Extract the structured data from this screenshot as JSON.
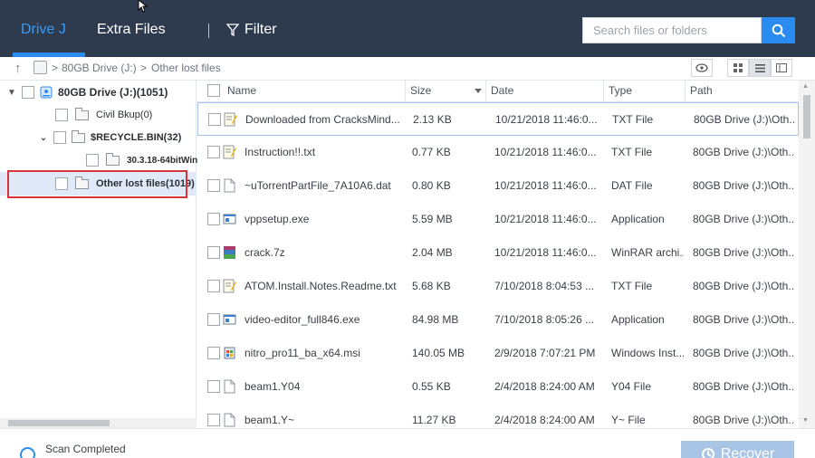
{
  "header": {
    "tabs": [
      {
        "label": "Drive J",
        "active": true
      },
      {
        "label": "Extra Files",
        "active": false
      }
    ],
    "filter_label": "Filter",
    "search": {
      "placeholder": "Search files or folders"
    }
  },
  "breadcrumb": {
    "items": [
      "80GB Drive (J:)",
      "Other lost files"
    ],
    "separator": ">"
  },
  "tree": {
    "root": {
      "label": "80GB Drive (J:)(1051)",
      "icon": "drive-icon"
    },
    "items": [
      {
        "label": "Civil Bkup(0)"
      },
      {
        "label": "$RECYCLE.BIN(32)"
      },
      {
        "label": "30.3.18-64bitWin"
      },
      {
        "label": "Other lost files(1019)",
        "selected": true
      }
    ]
  },
  "table": {
    "columns": [
      "Name",
      "Size",
      "Date",
      "Type",
      "Path"
    ],
    "rows": [
      {
        "icon": "txt-file-icon",
        "name": "Downloaded from CracksMind...",
        "size": "2.13 KB",
        "date": "10/21/2018 11:46:0...",
        "type": "TXT File",
        "path": "80GB Drive (J:)\\Oth..."
      },
      {
        "icon": "txt-file-icon",
        "name": "Instruction!!.txt",
        "size": "0.77 KB",
        "date": "10/21/2018 11:46:0...",
        "type": "TXT File",
        "path": "80GB Drive (J:)\\Oth..."
      },
      {
        "icon": "blank-file-icon",
        "name": "~uTorrentPartFile_7A10A6.dat",
        "size": "0.80 KB",
        "date": "10/21/2018 11:46:0...",
        "type": "DAT File",
        "path": "80GB Drive (J:)\\Oth..."
      },
      {
        "icon": "exe-file-icon",
        "name": "vppsetup.exe",
        "size": "5.59 MB",
        "date": "10/21/2018 11:46:0...",
        "type": "Application",
        "path": "80GB Drive (J:)\\Oth..."
      },
      {
        "icon": "archive-file-icon",
        "name": "crack.7z",
        "size": "2.04 MB",
        "date": "10/21/2018 11:46:0...",
        "type": "WinRAR archi...",
        "path": "80GB Drive (J:)\\Oth..."
      },
      {
        "icon": "txt-file-icon",
        "name": "ATOM.Install.Notes.Readme.txt",
        "size": "5.68 KB",
        "date": "7/10/2018 8:04:53 ...",
        "type": "TXT File",
        "path": "80GB Drive (J:)\\Oth..."
      },
      {
        "icon": "exe-file-icon",
        "name": "video-editor_full846.exe",
        "size": "84.98 MB",
        "date": "7/10/2018 8:05:26 ...",
        "type": "Application",
        "path": "80GB Drive (J:)\\Oth..."
      },
      {
        "icon": "msi-file-icon",
        "name": "nitro_pro11_ba_x64.msi",
        "size": "140.05 MB",
        "date": "2/9/2018 7:07:21 PM",
        "type": "Windows Inst...",
        "path": "80GB Drive (J:)\\Oth..."
      },
      {
        "icon": "blank-file-icon",
        "name": "beam1.Y04",
        "size": "0.55 KB",
        "date": "2/4/2018 8:24:00 AM",
        "type": "Y04 File",
        "path": "80GB Drive (J:)\\Oth..."
      },
      {
        "icon": "blank-file-icon",
        "name": "beam1.Y~",
        "size": "11.27 KB",
        "date": "2/4/2018 8:24:00 AM",
        "type": "Y~ File",
        "path": "80GB Drive (J:)\\Oth..."
      }
    ]
  },
  "status": {
    "text": "Scan Completed"
  },
  "recover_label": "Recover",
  "colors": {
    "header_bg": "#2e3a4e",
    "accent": "#2a8cf0",
    "highlight_box": "#d9343a"
  }
}
